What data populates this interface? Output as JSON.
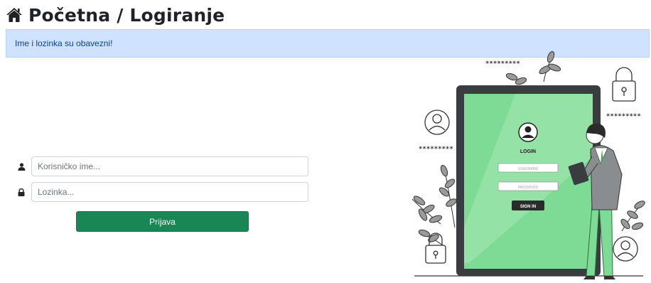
{
  "header": {
    "title": "Početna / Logiranje",
    "icon": "home-icon"
  },
  "alert": {
    "message": "Ime i lozinka su obavezni!",
    "color": "#cfe2ff"
  },
  "form": {
    "username_placeholder": "Korisničko ime...",
    "password_placeholder": "Lozinka...",
    "submit_label": "Prijava",
    "submit_color": "#198754"
  },
  "illustration": {
    "password_mask": "*********",
    "login_title": "LOGIN",
    "username_field": "USERNAME",
    "password_field": "PASSWORD",
    "sign_in": "SIGN IN",
    "screen_color": "#7edb95"
  }
}
